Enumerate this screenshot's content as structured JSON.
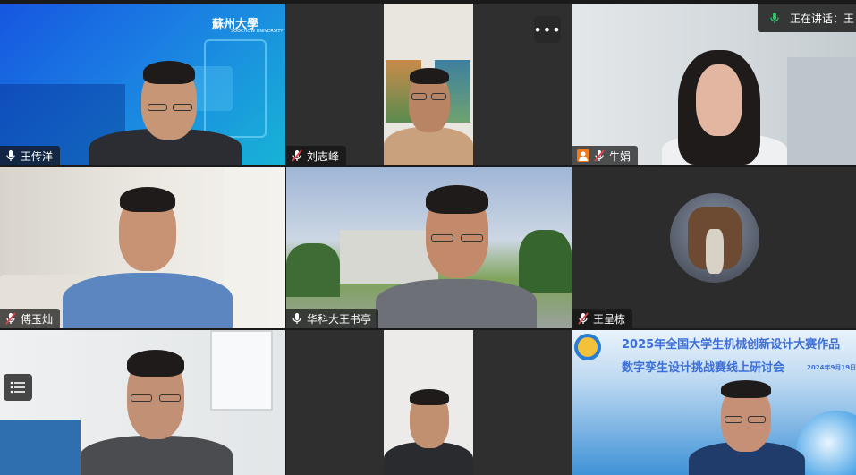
{
  "speaking": {
    "label": "正在讲话：",
    "name": "王"
  },
  "tile1_logo": "蘇州大學",
  "tile1_logo_sub": "SOOCHOW UNIVERSITY",
  "tiles": [
    {
      "name": "王传洋",
      "active": true
    },
    {
      "name": "刘志峰"
    },
    {
      "name": "牛娟"
    },
    {
      "name": "傅玉灿"
    },
    {
      "name": "华科大王书亭"
    },
    {
      "name": "王呈栋"
    },
    {
      "name": ""
    },
    {
      "name": ""
    },
    {
      "name": ""
    }
  ],
  "banner": {
    "line1": "2025年全国大学生机械创新设计大赛作品",
    "line2": "数字孪生设计挑战赛线上研讨会",
    "date": "2024年9月19日"
  },
  "colors": {
    "active_border": "#2fc36a",
    "mic_muted": "#e0424a",
    "banner_text": "#3d6fd6"
  }
}
